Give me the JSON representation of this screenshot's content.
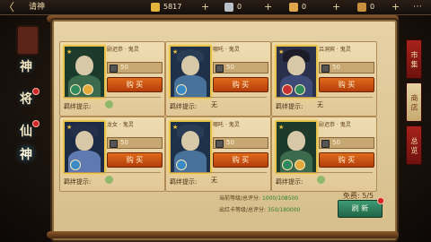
{
  "header": {
    "back_label": "〈",
    "title": "请神",
    "resources": [
      {
        "name": "gold",
        "icon": "gold-bar-icon",
        "value": "5817",
        "color": "#e4b53a"
      },
      {
        "name": "token",
        "icon": "silver-token-icon",
        "value": "0",
        "color": "#b8c0c8"
      },
      {
        "name": "scroll",
        "icon": "scroll-icon",
        "value": "0",
        "color": "#e0a64a"
      },
      {
        "name": "jade",
        "icon": "bag-icon",
        "value": "0",
        "color": "#c88f3e"
      }
    ],
    "plus_label": "+",
    "extra_button": "⋯"
  },
  "left_tabs": [
    {
      "label": "神",
      "icon": "lantern-icon"
    },
    {
      "label": "将",
      "icon": "general-tab-icon"
    },
    {
      "label": "仙",
      "icon": "immortal-tab-icon"
    },
    {
      "label": "神",
      "icon": "deity-tab-icon",
      "active": true
    }
  ],
  "right_tabs": [
    {
      "label": "市 集",
      "active": false
    },
    {
      "label": "商 店",
      "active": true
    },
    {
      "label": "总 览",
      "active": false
    }
  ],
  "cards": [
    {
      "name": "尉迟恭 · 鬼灵",
      "cost": "50",
      "buy_label": "购 买",
      "bond_label": "羁绊提示:",
      "bond_value": "",
      "hair": "#1f3a2a",
      "body": "#3b6a4c",
      "bg": "#1b3a2c",
      "ring1": "#2f8a5b",
      "ring2": "#e3a93a"
    },
    {
      "name": "哪吒 · 鬼灵",
      "cost": "50",
      "buy_label": "购 买",
      "bond_label": "羁绊提示:",
      "bond_value": "无",
      "hair": "#283c55",
      "body": "#48729a",
      "bg": "#1e3148",
      "ring1": "#3a8ac8",
      "ring2": ""
    },
    {
      "name": "吕洞宾 · 鬼灵",
      "cost": "50",
      "buy_label": "购 买",
      "bond_label": "羁绊提示:",
      "bond_value": "无",
      "hair": "#1c1c28",
      "body": "#3e4a78",
      "bg": "#2a2f4a",
      "ring1": "#c83232",
      "ring2": "#2f8a5b"
    },
    {
      "name": "龙女 · 鬼灵",
      "cost": "50",
      "buy_label": "购 买",
      "bond_label": "羁绊提示:",
      "bond_value": "",
      "hair": "#24304a",
      "body": "#5e7ab0",
      "bg": "#1d2a45",
      "ring1": "#3a8ac8",
      "ring2": ""
    },
    {
      "name": "哪吒 · 鬼灵",
      "cost": "50",
      "buy_label": "购 买",
      "bond_label": "羁绊提示:",
      "bond_value": "无",
      "hair": "#283c55",
      "body": "#48729a",
      "bg": "#1e3148",
      "ring1": "#3a8ac8",
      "ring2": ""
    },
    {
      "name": "尉迟恭 · 鬼灵",
      "cost": "50",
      "buy_label": "购 买",
      "bond_label": "羁绊提示:",
      "bond_value": "",
      "hair": "#1f3a2a",
      "body": "#3b6a4c",
      "bg": "#1b3a2c",
      "ring1": "#2f8a5b",
      "ring2": "#e3a93a"
    }
  ],
  "footer": {
    "stat1_label": "当前等级/总评分:",
    "stat1_value": "1000/108500",
    "stat2_label": "出红卡等级/总评分:",
    "stat2_value": "350/180000",
    "free_label": "免费: 5/5",
    "refresh_label": "刷 新"
  }
}
